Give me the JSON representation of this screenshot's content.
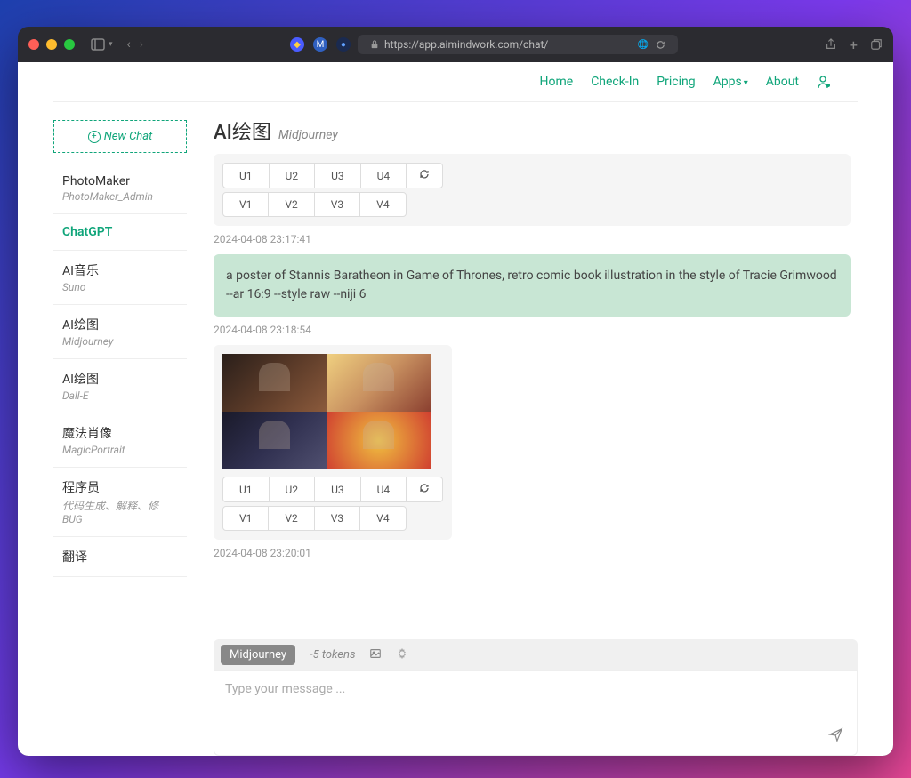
{
  "browser": {
    "url": "https://app.aimindwork.com/chat/"
  },
  "nav": {
    "home": "Home",
    "checkin": "Check-In",
    "pricing": "Pricing",
    "apps": "Apps",
    "about": "About"
  },
  "sidebar": {
    "new_chat": "New Chat",
    "items": [
      {
        "title": "PhotoMaker",
        "sub": "PhotoMaker_Admin"
      },
      {
        "title": "ChatGPT",
        "sub": ""
      },
      {
        "title": "AI音乐",
        "sub": "Suno"
      },
      {
        "title": "AI绘图",
        "sub": "Midjourney"
      },
      {
        "title": "AI绘图",
        "sub": "Dall-E"
      },
      {
        "title": "魔法肖像",
        "sub": "MagicPortrait"
      },
      {
        "title": "程序员",
        "sub": "代码生成、解释、修BUG"
      },
      {
        "title": "翻译",
        "sub": ""
      }
    ]
  },
  "chat": {
    "title": "AI绘图",
    "subtitle": "Midjourney"
  },
  "buttons": {
    "u1": "U1",
    "u2": "U2",
    "u3": "U3",
    "u4": "U4",
    "v1": "V1",
    "v2": "V2",
    "v3": "V3",
    "v4": "V4"
  },
  "messages": {
    "ts1": "2024-04-08 23:17:41",
    "user1": "a poster of Stannis Baratheon in Game of Thrones, retro comic book illustration in the style of Tracie Grimwood --ar 16:9 --style raw --niji 6",
    "ts2": "2024-04-08 23:18:54",
    "ts3": "2024-04-08 23:20:01"
  },
  "input": {
    "model": "Midjourney",
    "tokens": "-5 tokens",
    "placeholder": "Type your message ..."
  }
}
